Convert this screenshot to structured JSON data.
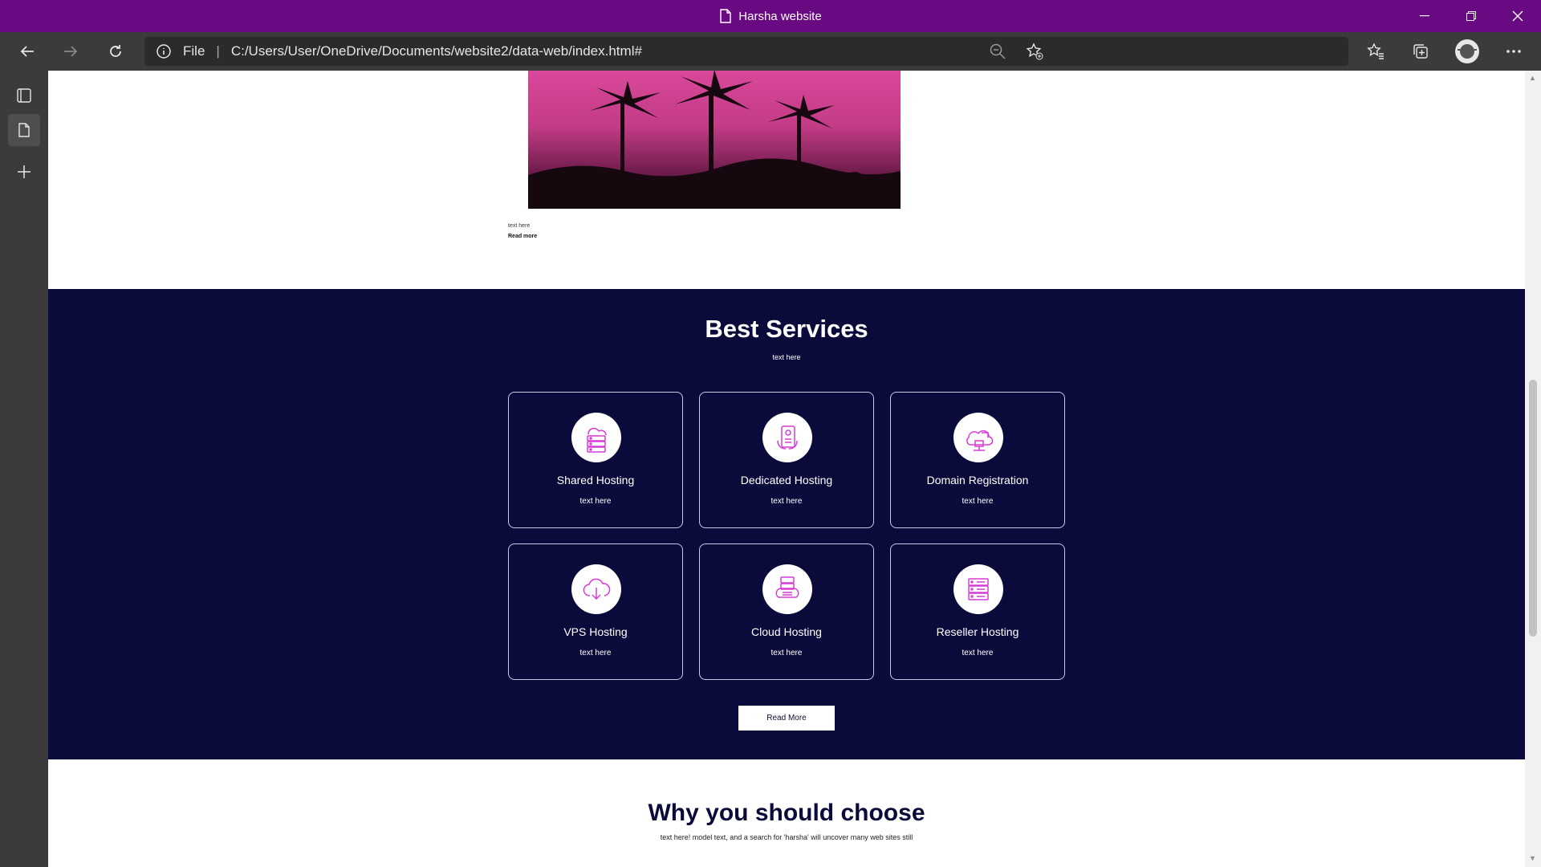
{
  "browser": {
    "window_title": "Harsha website",
    "address_scheme": "File",
    "address_url": "C:/Users/User/OneDrive/Documents/website2/data-web/index.html#"
  },
  "blog": {
    "text": "text here",
    "read_more": "Read more"
  },
  "services": {
    "title": "Best Services",
    "subtitle": "text here",
    "cards": [
      {
        "name": "Shared Hosting",
        "desc": "text here",
        "icon": "cloud-server-icon"
      },
      {
        "name": "Dedicated Hosting",
        "desc": "text here",
        "icon": "dedicated-server-icon"
      },
      {
        "name": "Domain Registration",
        "desc": "text here",
        "icon": "domain-cloud-icon"
      },
      {
        "name": "VPS Hosting",
        "desc": "text here",
        "icon": "cloud-download-icon"
      },
      {
        "name": "Cloud Hosting",
        "desc": "text here",
        "icon": "cloud-database-icon"
      },
      {
        "name": "Reseller Hosting",
        "desc": "text here",
        "icon": "server-stack-icon"
      }
    ],
    "button": "Read More"
  },
  "why": {
    "title": "Why you should choose",
    "text": "text here! model text, and a search for 'harsha' will uncover many web sites still"
  },
  "colors": {
    "titlebar": "#6a0a82",
    "services_bg": "#0b0b3b",
    "icon_accent": "#d63bd6"
  }
}
